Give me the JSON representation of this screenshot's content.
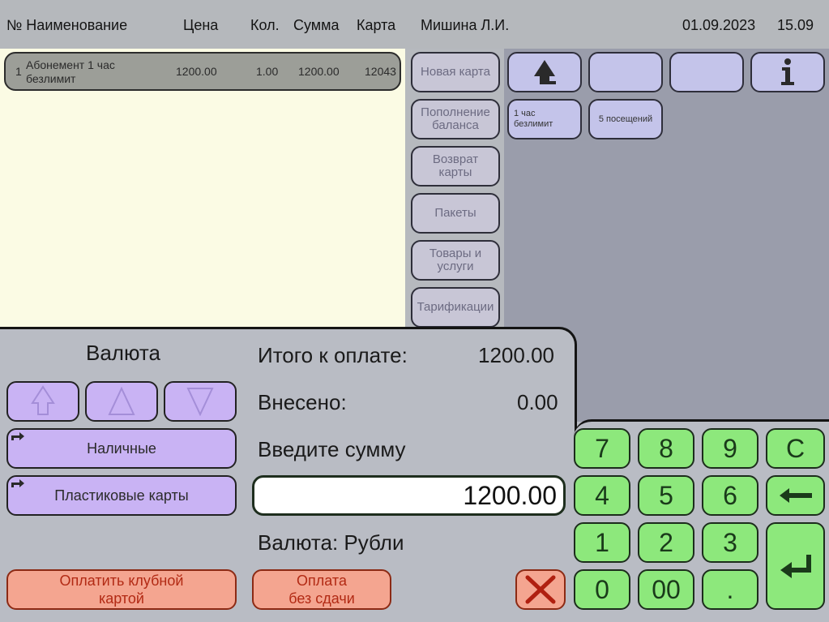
{
  "header": {
    "col_no_name": "№ Наименование",
    "col_price": "Цена",
    "col_qty": "Кол.",
    "col_sum": "Сумма",
    "col_card": "Карта",
    "operator": "Мишина Л.И.",
    "date": "01.09.2023",
    "time": "15.09"
  },
  "receipt": {
    "rows": [
      {
        "no": "1",
        "name_line1": "Абонемент 1 час",
        "name_line2": "безлимит",
        "price": "1200.00",
        "qty": "1.00",
        "sum": "1200.00",
        "card": "12043"
      }
    ]
  },
  "categories": {
    "new_card": "Новая карта",
    "topup_line1": "Пополнение",
    "topup_line2": "баланса",
    "return_line1": "Возврат",
    "return_line2": "карты",
    "packages": "Пакеты",
    "goods_line1": "Товары и",
    "goods_line2": "услуги",
    "tariff": "Тарификации"
  },
  "products": {
    "item1_line1": "1 час",
    "item1_line2": "безлимит",
    "item2": "5 посещений"
  },
  "payment": {
    "currency_title": "Валюта",
    "cash": "Наличные",
    "plastic": "Пластиковые карты",
    "total_label": "Итого к оплате:",
    "total_value": "1200.00",
    "paid_label": "Внесено:",
    "paid_value": "0.00",
    "enter_label": "Введите сумму",
    "amount_value": "1200.00",
    "currency_label": "Валюта: Рубли",
    "club_line1": "Оплатить клубной",
    "club_line2": "картой",
    "nochange_line1": "Оплата",
    "nochange_line2": "без сдачи"
  },
  "keypad": {
    "k7": "7",
    "k8": "8",
    "k9": "9",
    "kc": "C",
    "k4": "4",
    "k5": "5",
    "k6": "6",
    "k1": "1",
    "k2": "2",
    "k3": "3",
    "k0": "0",
    "k00": "00",
    "kdot": "."
  },
  "colors": {
    "accent_purple": "#c9b3f4",
    "keypad_green": "#8de87c",
    "pay_red": "#f4a590",
    "receipt_bg": "#fbfbe4"
  },
  "icons": {
    "up": "arrow-up-icon",
    "info": "info-icon",
    "cancel": "cancel-x-icon",
    "backspace": "backspace-icon",
    "enter": "enter-icon"
  }
}
